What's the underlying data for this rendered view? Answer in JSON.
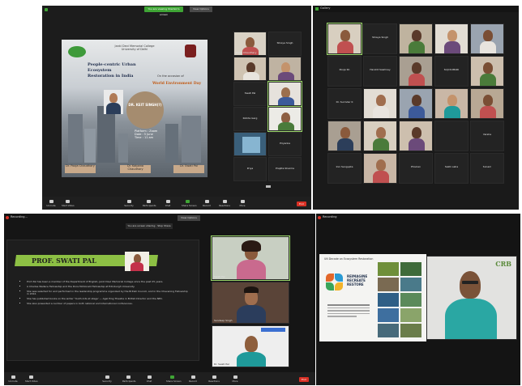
{
  "s1": {
    "top_banner": "You are viewing Shamini's screen",
    "view_options": "View Options",
    "poster": {
      "college_line1": "Janki Devi Memorial College",
      "college_line2": "University of Delhi",
      "college_line3": "",
      "title_line1": "People-centric Urban Ecosystem",
      "title_line2": "Restoration in India",
      "occasion_prefix": "On the occasion of",
      "occasion": "World Environment Day",
      "speaker_title": "DR. KEIT SINGH(?)",
      "speaker_desc1": "",
      "speaker_desc2": "",
      "details1": "Platform : Zoom",
      "details2": "Date : 5 June",
      "details3": "Time : 11 am",
      "footer1": "Dr. Pooja Chaudhary",
      "footer2": "Dr. Kalpana Chaudhary",
      "footer3": "Dr. Swati Pal"
    },
    "tiles": [
      {
        "name": "Pooja Chaudhary",
        "photo": true
      },
      {
        "name": "Shreya Singh",
        "photo": false
      },
      {
        "name": "",
        "photo": true
      },
      {
        "name": "",
        "photo": true
      },
      {
        "name": "Swati Pal",
        "photo": false
      },
      {
        "name": "",
        "photo": true
      },
      {
        "name": "Rohita Garg",
        "photo": false
      },
      {
        "name": "",
        "photo": true
      },
      {
        "name": "",
        "photo": true
      },
      {
        "name": "Priyanka",
        "photo": false
      },
      {
        "name": "Priya",
        "photo": false
      },
      {
        "name": "Prajkta Sharma",
        "photo": false
      }
    ],
    "toolbar": [
      "Unmute",
      "Start Video",
      "Security",
      "Participants",
      "Chat",
      "Share Screen",
      "Record",
      "Reactions",
      "More"
    ],
    "end": "End"
  },
  "s2": {
    "title": "Gallery",
    "tiles": [
      {
        "name": "",
        "photo": true,
        "selected": true
      },
      {
        "name": "Shreya Singh",
        "photo": false
      },
      {
        "name": "",
        "photo": true
      },
      {
        "name": "",
        "photo": true
      },
      {
        "name": "",
        "photo": true
      },
      {
        "name": "Pooja Sh",
        "photo": false
      },
      {
        "name": "Harshit Sawhney",
        "photo": false
      },
      {
        "name": "",
        "photo": true
      },
      {
        "name": "SUJI KUMARI",
        "photo": false
      },
      {
        "name": "",
        "photo": true
      },
      {
        "name": "Dr. Surinder K",
        "photo": false
      },
      {
        "name": "",
        "photo": true
      },
      {
        "name": "",
        "photo": true
      },
      {
        "name": "",
        "photo": true
      },
      {
        "name": "",
        "photo": true
      },
      {
        "name": "",
        "photo": true
      },
      {
        "name": "",
        "photo": true
      },
      {
        "name": "",
        "photo": true
      },
      {
        "name": "",
        "photo": false
      },
      {
        "name": "Varsha",
        "photo": false
      },
      {
        "name": "Inni Sengupta",
        "photo": false
      },
      {
        "name": "",
        "photo": true
      },
      {
        "name": "Phoolan",
        "photo": false
      },
      {
        "name": "Sakhi saha",
        "photo": false
      },
      {
        "name": "Sonam",
        "photo": false
      }
    ]
  },
  "s3": {
    "recording": "Recording...",
    "banner": "You are screen sharing · Stop Share",
    "view_options": "View Options",
    "slide_heading": "PROF. SWATI PAL",
    "bullets": [
      "Prof. Pal has been a member of the Department of English, Janki Devi Memorial College since the past 25 years.",
      "A Charles Wallace Fellowship and the Dora McDonald Fellowship at Edinburgh University.",
      "She was selected for and performed in the leadership programme organized by the British Council, and in the Chevening Fellowship in 2012.",
      "She has published books on the writer 'Youth Arts at stage' — Agel Ping Theatre in British Director and the NEC.",
      "She also presented a number of papers in both national and international conferences."
    ],
    "tiles": [
      {
        "name": "Swati Pal"
      },
      {
        "name": "Sandeep Singh"
      },
      {
        "name": "Dr. Swati Pal"
      }
    ],
    "toolbar": [
      "Unmute",
      "Start Video",
      "Security",
      "Participants",
      "Chat",
      "Share Screen",
      "Record",
      "Reactions",
      "More"
    ],
    "end": "End"
  },
  "s4": {
    "recording": "Recording",
    "slide": {
      "header": "UN Decade on Ecosystem Restoration",
      "logo_text1": "REIMAGINE",
      "logo_text2": "RECREATE",
      "logo_text3": "RESTORE",
      "brand": "CRB",
      "sub": "",
      "caption": ""
    },
    "speaker_name": ""
  }
}
